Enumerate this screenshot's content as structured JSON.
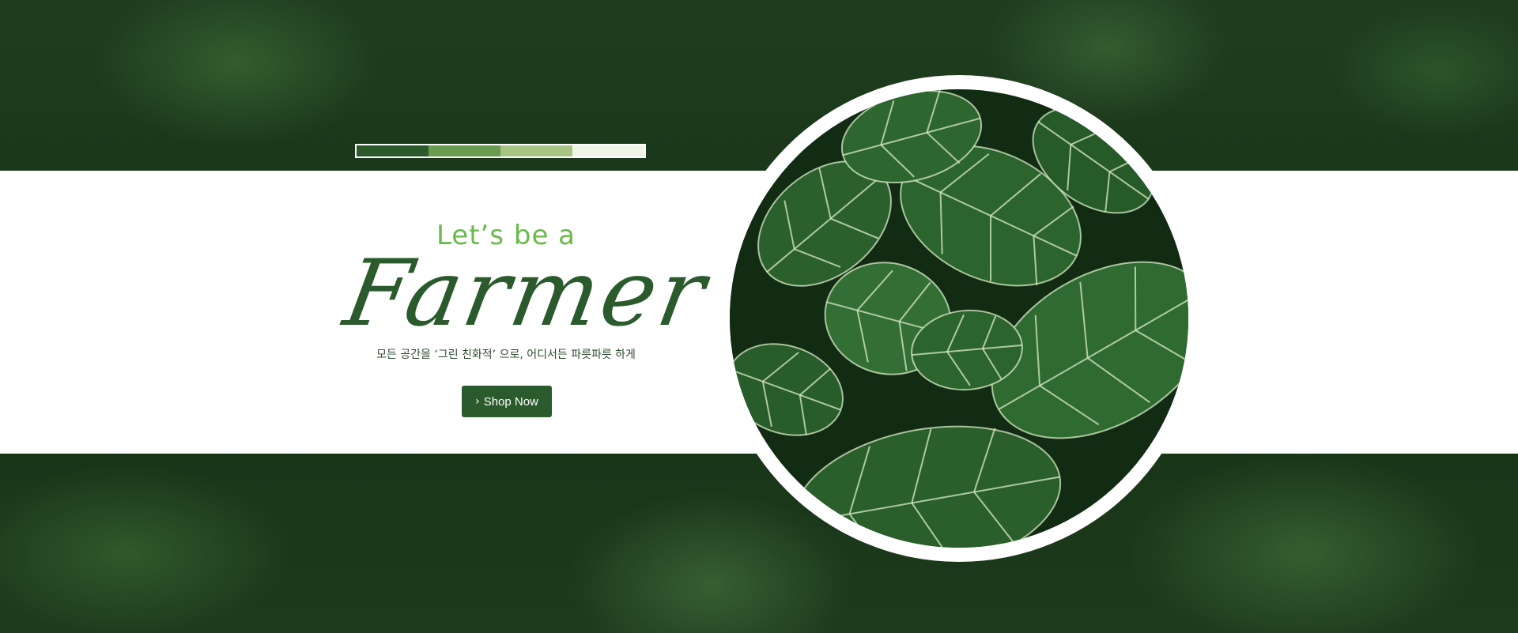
{
  "hero": {
    "tagline": "Let’s be a",
    "headline": "Farmer",
    "subtitle": "모든 공간을 ‘그린 친화적’ 으로, 어디서든 파릇파릇 하게",
    "cta": {
      "icon": "chevron-right-icon",
      "label": "Shop Now"
    }
  },
  "palette": {
    "swatches": [
      "#2b5a2c",
      "#6a9b4e",
      "#a8c482",
      "#eef5e6"
    ]
  },
  "theme": {
    "accent": "#6ab94a",
    "primary": "#2b5a2c",
    "band": "#ffffff"
  }
}
